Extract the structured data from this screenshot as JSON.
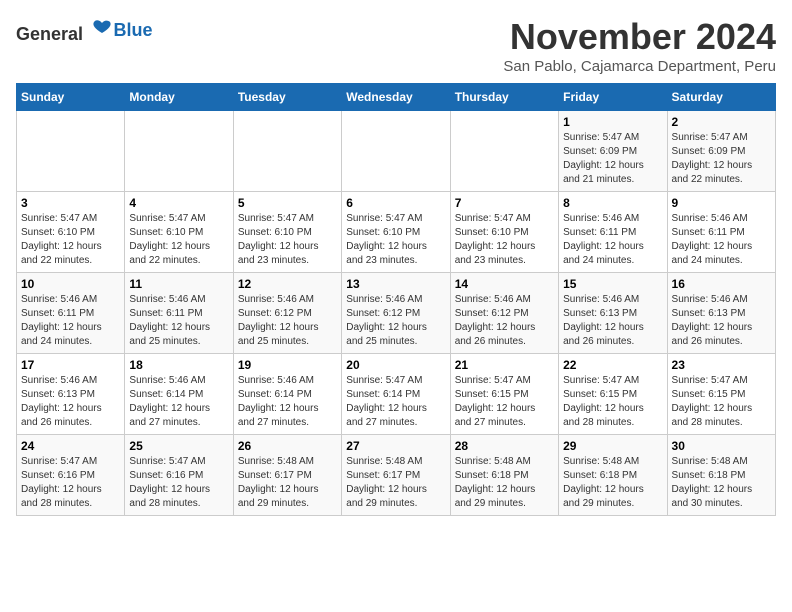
{
  "logo": {
    "general": "General",
    "blue": "Blue"
  },
  "title": "November 2024",
  "subtitle": "San Pablo, Cajamarca Department, Peru",
  "weekdays": [
    "Sunday",
    "Monday",
    "Tuesday",
    "Wednesday",
    "Thursday",
    "Friday",
    "Saturday"
  ],
  "weeks": [
    [
      {
        "day": "",
        "info": ""
      },
      {
        "day": "",
        "info": ""
      },
      {
        "day": "",
        "info": ""
      },
      {
        "day": "",
        "info": ""
      },
      {
        "day": "",
        "info": ""
      },
      {
        "day": "1",
        "info": "Sunrise: 5:47 AM\nSunset: 6:09 PM\nDaylight: 12 hours and 21 minutes."
      },
      {
        "day": "2",
        "info": "Sunrise: 5:47 AM\nSunset: 6:09 PM\nDaylight: 12 hours and 22 minutes."
      }
    ],
    [
      {
        "day": "3",
        "info": "Sunrise: 5:47 AM\nSunset: 6:10 PM\nDaylight: 12 hours and 22 minutes."
      },
      {
        "day": "4",
        "info": "Sunrise: 5:47 AM\nSunset: 6:10 PM\nDaylight: 12 hours and 22 minutes."
      },
      {
        "day": "5",
        "info": "Sunrise: 5:47 AM\nSunset: 6:10 PM\nDaylight: 12 hours and 23 minutes."
      },
      {
        "day": "6",
        "info": "Sunrise: 5:47 AM\nSunset: 6:10 PM\nDaylight: 12 hours and 23 minutes."
      },
      {
        "day": "7",
        "info": "Sunrise: 5:47 AM\nSunset: 6:10 PM\nDaylight: 12 hours and 23 minutes."
      },
      {
        "day": "8",
        "info": "Sunrise: 5:46 AM\nSunset: 6:11 PM\nDaylight: 12 hours and 24 minutes."
      },
      {
        "day": "9",
        "info": "Sunrise: 5:46 AM\nSunset: 6:11 PM\nDaylight: 12 hours and 24 minutes."
      }
    ],
    [
      {
        "day": "10",
        "info": "Sunrise: 5:46 AM\nSunset: 6:11 PM\nDaylight: 12 hours and 24 minutes."
      },
      {
        "day": "11",
        "info": "Sunrise: 5:46 AM\nSunset: 6:11 PM\nDaylight: 12 hours and 25 minutes."
      },
      {
        "day": "12",
        "info": "Sunrise: 5:46 AM\nSunset: 6:12 PM\nDaylight: 12 hours and 25 minutes."
      },
      {
        "day": "13",
        "info": "Sunrise: 5:46 AM\nSunset: 6:12 PM\nDaylight: 12 hours and 25 minutes."
      },
      {
        "day": "14",
        "info": "Sunrise: 5:46 AM\nSunset: 6:12 PM\nDaylight: 12 hours and 26 minutes."
      },
      {
        "day": "15",
        "info": "Sunrise: 5:46 AM\nSunset: 6:13 PM\nDaylight: 12 hours and 26 minutes."
      },
      {
        "day": "16",
        "info": "Sunrise: 5:46 AM\nSunset: 6:13 PM\nDaylight: 12 hours and 26 minutes."
      }
    ],
    [
      {
        "day": "17",
        "info": "Sunrise: 5:46 AM\nSunset: 6:13 PM\nDaylight: 12 hours and 26 minutes."
      },
      {
        "day": "18",
        "info": "Sunrise: 5:46 AM\nSunset: 6:14 PM\nDaylight: 12 hours and 27 minutes."
      },
      {
        "day": "19",
        "info": "Sunrise: 5:46 AM\nSunset: 6:14 PM\nDaylight: 12 hours and 27 minutes."
      },
      {
        "day": "20",
        "info": "Sunrise: 5:47 AM\nSunset: 6:14 PM\nDaylight: 12 hours and 27 minutes."
      },
      {
        "day": "21",
        "info": "Sunrise: 5:47 AM\nSunset: 6:15 PM\nDaylight: 12 hours and 27 minutes."
      },
      {
        "day": "22",
        "info": "Sunrise: 5:47 AM\nSunset: 6:15 PM\nDaylight: 12 hours and 28 minutes."
      },
      {
        "day": "23",
        "info": "Sunrise: 5:47 AM\nSunset: 6:15 PM\nDaylight: 12 hours and 28 minutes."
      }
    ],
    [
      {
        "day": "24",
        "info": "Sunrise: 5:47 AM\nSunset: 6:16 PM\nDaylight: 12 hours and 28 minutes."
      },
      {
        "day": "25",
        "info": "Sunrise: 5:47 AM\nSunset: 6:16 PM\nDaylight: 12 hours and 28 minutes."
      },
      {
        "day": "26",
        "info": "Sunrise: 5:48 AM\nSunset: 6:17 PM\nDaylight: 12 hours and 29 minutes."
      },
      {
        "day": "27",
        "info": "Sunrise: 5:48 AM\nSunset: 6:17 PM\nDaylight: 12 hours and 29 minutes."
      },
      {
        "day": "28",
        "info": "Sunrise: 5:48 AM\nSunset: 6:18 PM\nDaylight: 12 hours and 29 minutes."
      },
      {
        "day": "29",
        "info": "Sunrise: 5:48 AM\nSunset: 6:18 PM\nDaylight: 12 hours and 29 minutes."
      },
      {
        "day": "30",
        "info": "Sunrise: 5:48 AM\nSunset: 6:18 PM\nDaylight: 12 hours and 30 minutes."
      }
    ]
  ]
}
